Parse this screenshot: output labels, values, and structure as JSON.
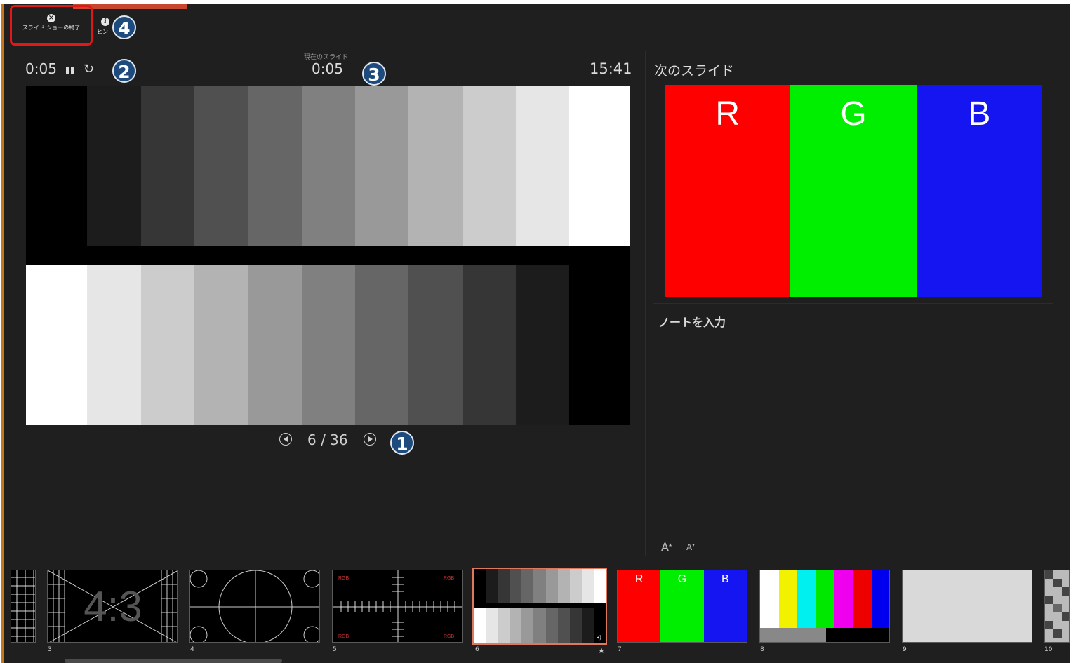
{
  "toolbar": {
    "end_show_label": "スライド ショーの終了",
    "hint_label": "ヒン"
  },
  "badges": {
    "b1": "1",
    "b2": "2",
    "b3": "3",
    "b4": "4"
  },
  "timer": {
    "elapsed": "0:05",
    "current_slide_label": "現在のスライド",
    "current_slide_time": "0:05",
    "clock": "15:41"
  },
  "navigation": {
    "counter": "6 / 36",
    "current_index": 6,
    "total": 36
  },
  "next_slide": {
    "title": "次のスライド",
    "letters": [
      "R",
      "G",
      "B"
    ]
  },
  "notes": {
    "placeholder": "ノートを入力",
    "font_increase": "A",
    "font_decrease": "A"
  },
  "grayscale_top": [
    "#000000",
    "#1c1c1c",
    "#363636",
    "#505050",
    "#666666",
    "#808080",
    "#999999",
    "#b3b3b3",
    "#cccccc",
    "#e6e6e6",
    "#ffffff"
  ],
  "grayscale_bottom": [
    "#ffffff",
    "#e6e6e6",
    "#cccccc",
    "#b3b3b3",
    "#999999",
    "#808080",
    "#666666",
    "#505050",
    "#363636",
    "#1c1c1c",
    "#000000"
  ],
  "colors": {
    "red": "#ff0000",
    "green": "#00ee00",
    "blue": "#1515f2",
    "bars": [
      "#ffffff",
      "#f2f200",
      "#00f0f0",
      "#00e800",
      "#ee00ee",
      "#ee0000",
      "#0000ee"
    ],
    "accent": "#c4472e",
    "highlight": "#e01818",
    "badge": "#1e4b7d"
  },
  "thumbnails": [
    {
      "num": "3",
      "kind": "4:3 test",
      "text": "4:3"
    },
    {
      "num": "4",
      "kind": "circle test",
      "text": ""
    },
    {
      "num": "5",
      "kind": "rgb crosshair",
      "text": "RGB"
    },
    {
      "num": "6",
      "kind": "grayscale",
      "text": "",
      "selected": true
    },
    {
      "num": "7",
      "kind": "rgb",
      "text": ""
    },
    {
      "num": "8",
      "kind": "color bars",
      "text": ""
    },
    {
      "num": "9",
      "kind": "gray",
      "text": ""
    },
    {
      "num": "10",
      "kind": "checker",
      "text": ""
    }
  ]
}
